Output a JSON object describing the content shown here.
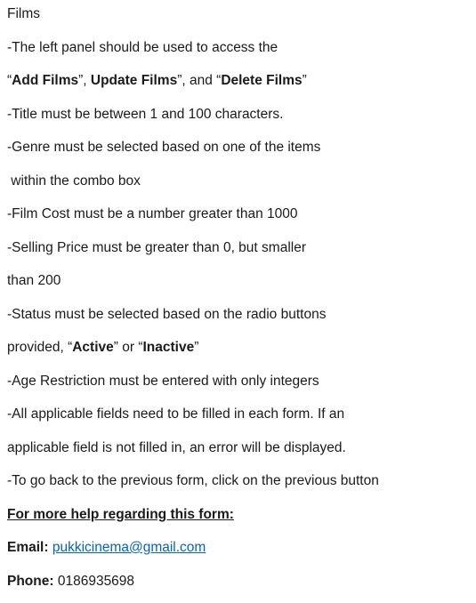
{
  "doc": {
    "title": "Films",
    "l1": "-The left panel should be used to access the",
    "l2": {
      "q1": "“",
      "add": "Add Films",
      "q2": "”, ",
      "update": "Update Films",
      "q3": "”, and “",
      "delete": "Delete Films",
      "q4": "”"
    },
    "l3": "-Title must be between 1 and 100 characters.",
    "l4": "-Genre must be selected based on one of the items",
    "l5": " within the combo box",
    "l6": "-Film Cost must be a number greater than 1000",
    "l7": "-Selling Price must be greater than 0, but smaller",
    "l8": "than 200",
    "l9": "-Status must be selected based on the radio buttons",
    "l10": {
      "pre": "provided, “",
      "active": "Active",
      "mid": "” or “",
      "inactive": "Inactive",
      "post": "”"
    },
    "l11": "-Age Restriction must be entered with only integers",
    "l12": "-All applicable fields need to be filled in each form. If an",
    "l13": "applicable field is not filled in, an error will be displayed.",
    "l14": "-To go back to the previous form, click on the previous button",
    "help_heading": "For more help regarding this form:",
    "email_label": "Email:",
    "email_value": "pukkicinema@gmail.com",
    "phone_label": "Phone:",
    "phone_value": "0186935698"
  },
  "colors": {
    "text": "#1a1a1a",
    "link": "#0563c1"
  }
}
